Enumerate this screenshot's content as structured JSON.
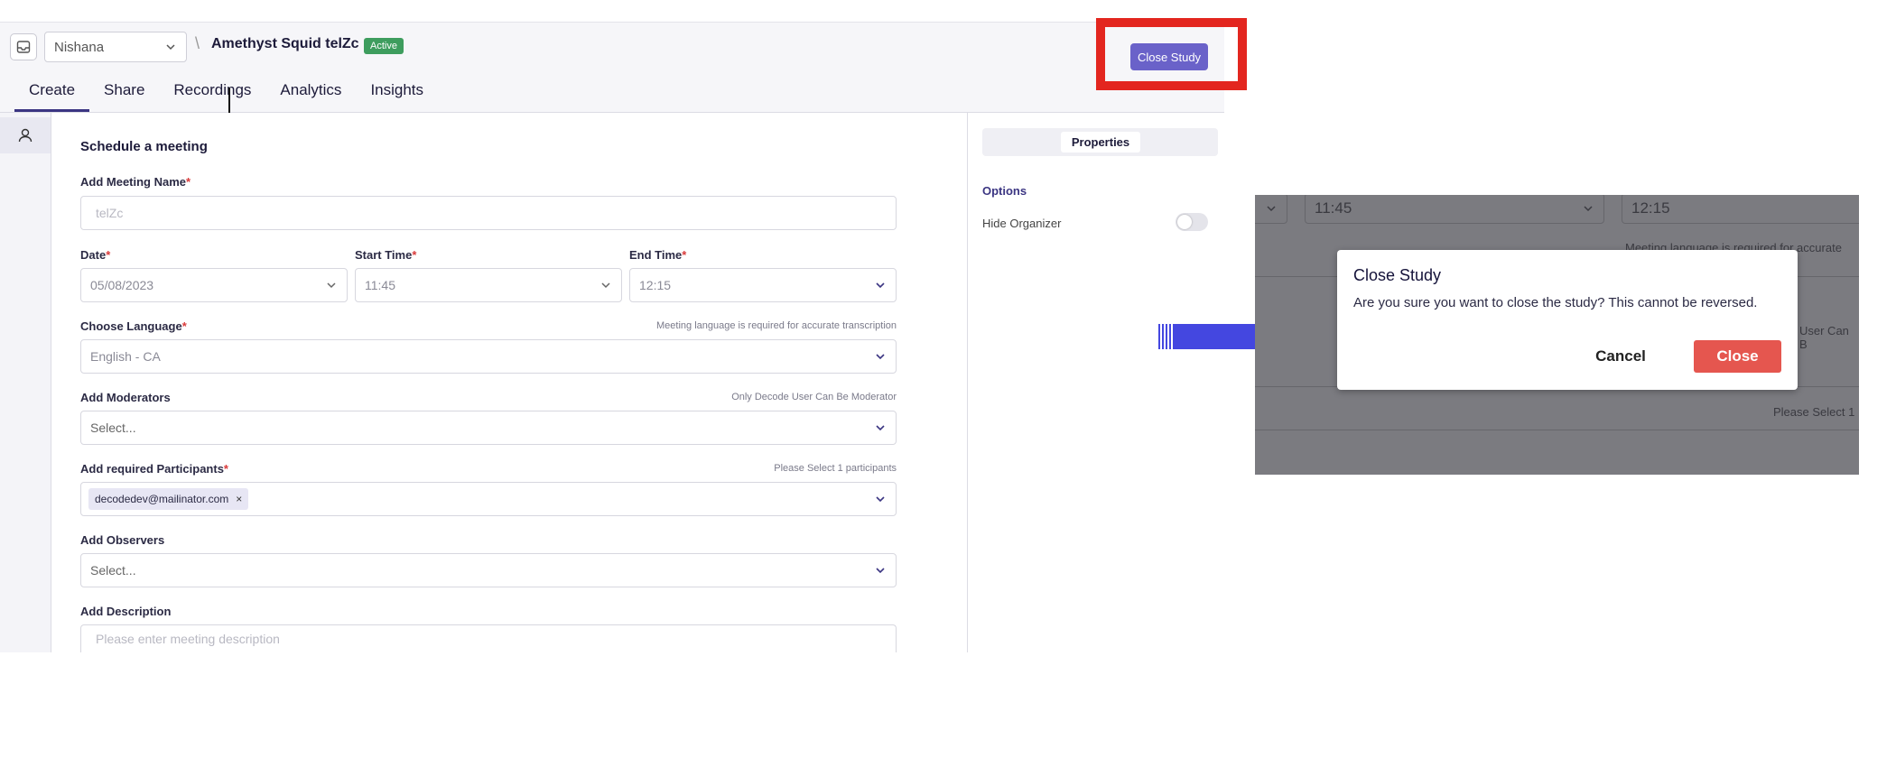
{
  "colors": {
    "accent": "#3b3582",
    "close_study_button": "#6a62c9",
    "active_badge": "#3e9d5e",
    "highlight_box": "#e3261f",
    "arrow": "#4447e0",
    "dialog_close_button": "#e5564f"
  },
  "header": {
    "workspace_value": "Nishana",
    "separator": "\\",
    "study_name": "Amethyst Squid telZc",
    "status_badge": "Active",
    "close_study_label": "Close Study"
  },
  "tabs": [
    {
      "label": "Create",
      "active": true
    },
    {
      "label": "Share",
      "active": false
    },
    {
      "label": "Recordings",
      "active": false
    },
    {
      "label": "Analytics",
      "active": false
    },
    {
      "label": "Insights",
      "active": false
    }
  ],
  "form": {
    "title": "Schedule a meeting",
    "meeting_name": {
      "label": "Add Meeting Name",
      "required_mark": "*",
      "placeholder": "telZc"
    },
    "date": {
      "label": "Date",
      "required_mark": "*",
      "value": "05/08/2023"
    },
    "start_time": {
      "label": "Start Time",
      "required_mark": "*",
      "value": "11:45"
    },
    "end_time": {
      "label": "End Time",
      "required_mark": "*",
      "value": "12:15"
    },
    "language": {
      "label": "Choose Language",
      "required_mark": "*",
      "hint": "Meeting language is required for accurate transcription",
      "value": "English - CA"
    },
    "moderators": {
      "label": "Add Moderators",
      "hint": "Only Decode User Can Be Moderator",
      "placeholder": "Select..."
    },
    "participants": {
      "label": "Add required Participants",
      "required_mark": "*",
      "hint": "Please Select 1 participants",
      "chip": "decodedev@mailinator.com",
      "chip_remove": "×"
    },
    "observers": {
      "label": "Add Observers",
      "placeholder": "Select..."
    },
    "description": {
      "label": "Add Description",
      "placeholder": "Please enter meeting description"
    }
  },
  "panel": {
    "tab": "Properties",
    "options_title": "Options",
    "hide_organizer_label": "Hide Organizer",
    "hide_organizer_on": false
  },
  "zoom_background": {
    "start_time": "11:45",
    "end_time": "12:15",
    "hint_language": "Meeting language is required for accurate",
    "hint_moderator": "User Can B",
    "hint_participants": "Please Select 1"
  },
  "dialog": {
    "title": "Close Study",
    "message": "Are you sure you want to close the study? This cannot be reversed.",
    "cancel_label": "Cancel",
    "close_label": "Close"
  }
}
